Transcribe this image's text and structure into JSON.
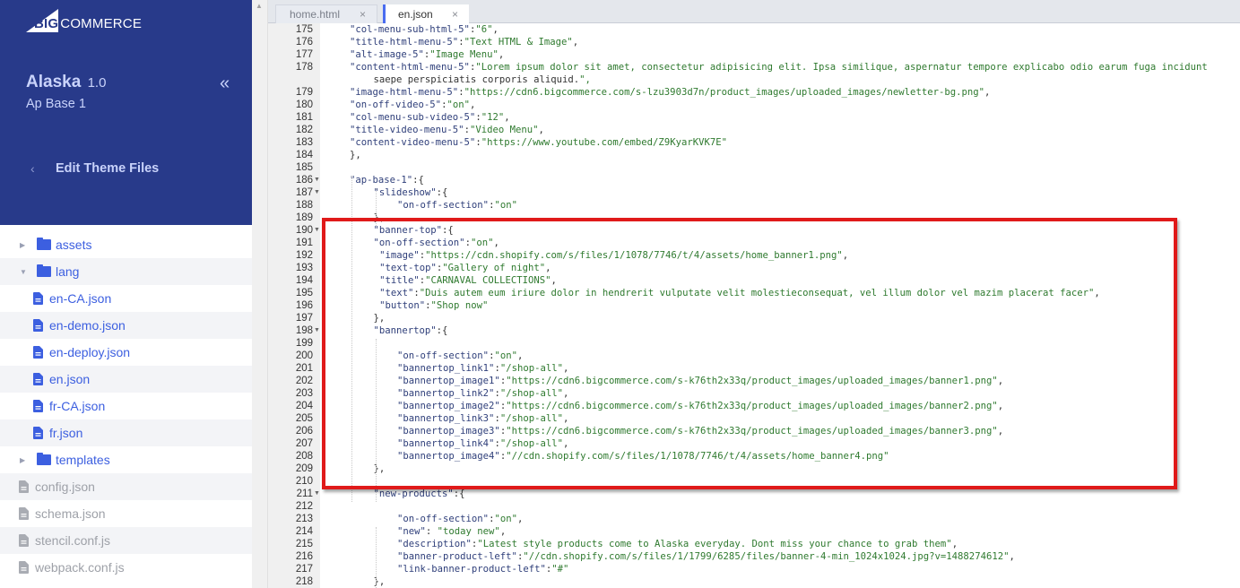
{
  "brand": {
    "logo_text_big": "BIG",
    "logo_text_rest": "COMMERCE",
    "accent": "#283a8a",
    "link_blue": "#3c5fe0"
  },
  "theme": {
    "name": "Alaska",
    "version": "1.0",
    "variant": "Ap Base 1"
  },
  "sidebar": {
    "collapse_icon": "double-chevron-left-icon",
    "back_label": "Edit Theme Files",
    "tree": [
      {
        "label": "assets",
        "type": "folder",
        "expanded": false,
        "level": 0
      },
      {
        "label": "lang",
        "type": "folder",
        "expanded": true,
        "level": 0
      },
      {
        "label": "en-CA.json",
        "type": "file",
        "level": 1
      },
      {
        "label": "en-demo.json",
        "type": "file",
        "level": 1
      },
      {
        "label": "en-deploy.json",
        "type": "file",
        "level": 1
      },
      {
        "label": "en.json",
        "type": "file",
        "level": 1
      },
      {
        "label": "fr-CA.json",
        "type": "file",
        "level": 1
      },
      {
        "label": "fr.json",
        "type": "file",
        "level": 1
      },
      {
        "label": "templates",
        "type": "folder",
        "expanded": false,
        "level": 0
      },
      {
        "label": "config.json",
        "type": "root-file",
        "level": 0
      },
      {
        "label": "schema.json",
        "type": "root-file",
        "level": 0
      },
      {
        "label": "stencil.conf.js",
        "type": "root-file",
        "level": 0
      },
      {
        "label": "webpack.conf.js",
        "type": "root-file",
        "level": 0
      }
    ]
  },
  "tabs": [
    {
      "label": "home.html",
      "active": false,
      "close": "×"
    },
    {
      "label": "en.json",
      "active": true,
      "close": "×"
    }
  ],
  "editor": {
    "lines": [
      {
        "n": "175",
        "ind": 1,
        "text": "\"col-menu-sub-html-5\":\"6\","
      },
      {
        "n": "176",
        "ind": 1,
        "text": "\"title-html-menu-5\":\"Text HTML & Image\","
      },
      {
        "n": "177",
        "ind": 1,
        "text": "\"alt-image-5\":\"Image Menu\","
      },
      {
        "n": "178",
        "ind": 1,
        "text": "\"content-html-menu-5\":\"Lorem ipsum dolor sit amet, consectetur adipisicing elit. Ipsa similique, aspernatur tempore explicabo odio earum fuga incidunt"
      },
      {
        "n": "",
        "ind": 2,
        "text": "saepe perspiciatis corporis aliquid.\","
      },
      {
        "n": "179",
        "ind": 1,
        "text": "\"image-html-menu-5\":\"https://cdn6.bigcommerce.com/s-lzu3903d7n/product_images/uploaded_images/newletter-bg.png\","
      },
      {
        "n": "180",
        "ind": 1,
        "text": "\"on-off-video-5\":\"on\","
      },
      {
        "n": "181",
        "ind": 1,
        "text": "\"col-menu-sub-video-5\":\"12\","
      },
      {
        "n": "182",
        "ind": 1,
        "text": "\"title-video-menu-5\":\"Video Menu\","
      },
      {
        "n": "183",
        "ind": 1,
        "text": "\"content-video-menu-5\":\"https://www.youtube.com/embed/Z9KyarKVK7E\""
      },
      {
        "n": "184",
        "ind": 1,
        "text": "},"
      },
      {
        "n": "185",
        "ind": 0,
        "text": ""
      },
      {
        "n": "186",
        "ind": 1,
        "text": "\"ap-base-1\":{",
        "fold": true
      },
      {
        "n": "187",
        "ind": 2,
        "text": "\"slideshow\":{",
        "fold": true
      },
      {
        "n": "188",
        "ind": 3,
        "text": "\"on-off-section\":\"on\""
      },
      {
        "n": "189",
        "ind": 2,
        "text": "},"
      },
      {
        "n": "190",
        "ind": 2,
        "text": "\"banner-top\":{",
        "fold": true
      },
      {
        "n": "191",
        "ind": 2,
        "text": "\"on-off-section\":\"on\","
      },
      {
        "n": "192",
        "ind": 2.25,
        "text": "\"image\":\"https://cdn.shopify.com/s/files/1/1078/7746/t/4/assets/home_banner1.png\","
      },
      {
        "n": "193",
        "ind": 2.25,
        "text": "\"text-top\":\"Gallery of night\","
      },
      {
        "n": "194",
        "ind": 2.25,
        "text": "\"title\":\"CARNAVAL COLLECTIONS\","
      },
      {
        "n": "195",
        "ind": 2.25,
        "text": "\"text\":\"Duis autem eum iriure dolor in hendrerit vulputate velit molestieconsequat, vel illum dolor vel mazim placerat facer\","
      },
      {
        "n": "196",
        "ind": 2.25,
        "text": "\"button\":\"Shop now\""
      },
      {
        "n": "197",
        "ind": 2,
        "text": "},"
      },
      {
        "n": "198",
        "ind": 2,
        "text": "\"bannertop\":{",
        "fold": true
      },
      {
        "n": "199",
        "ind": 0,
        "text": ""
      },
      {
        "n": "200",
        "ind": 3,
        "text": "\"on-off-section\":\"on\","
      },
      {
        "n": "201",
        "ind": 3,
        "text": "\"bannertop_link1\":\"/shop-all\","
      },
      {
        "n": "202",
        "ind": 3,
        "text": "\"bannertop_image1\":\"https://cdn6.bigcommerce.com/s-k76th2x33q/product_images/uploaded_images/banner1.png\","
      },
      {
        "n": "203",
        "ind": 3,
        "text": "\"bannertop_link2\":\"/shop-all\","
      },
      {
        "n": "204",
        "ind": 3,
        "text": "\"bannertop_image2\":\"https://cdn6.bigcommerce.com/s-k76th2x33q/product_images/uploaded_images/banner2.png\","
      },
      {
        "n": "205",
        "ind": 3,
        "text": "\"bannertop_link3\":\"/shop-all\","
      },
      {
        "n": "206",
        "ind": 3,
        "text": "\"bannertop_image3\":\"https://cdn6.bigcommerce.com/s-k76th2x33q/product_images/uploaded_images/banner3.png\","
      },
      {
        "n": "207",
        "ind": 3,
        "text": "\"bannertop_link4\":\"/shop-all\","
      },
      {
        "n": "208",
        "ind": 3,
        "text": "\"bannertop_image4\":\"//cdn.shopify.com/s/files/1/1078/7746/t/4/assets/home_banner4.png\""
      },
      {
        "n": "209",
        "ind": 2,
        "text": "},"
      },
      {
        "n": "210",
        "ind": 0,
        "text": ""
      },
      {
        "n": "211",
        "ind": 2,
        "text": "\"new-products\":{",
        "fold": true
      },
      {
        "n": "212",
        "ind": 0,
        "text": ""
      },
      {
        "n": "213",
        "ind": 3,
        "text": "\"on-off-section\":\"on\","
      },
      {
        "n": "214",
        "ind": 3,
        "text": "\"new\": \"today new\","
      },
      {
        "n": "215",
        "ind": 3,
        "text": "\"description\":\"Latest style products come to Alaska everyday. Dont miss your chance to grab them\","
      },
      {
        "n": "216",
        "ind": 3,
        "text": "\"banner-product-left\":\"//cdn.shopify.com/s/files/1/1799/6285/files/banner-4-min_1024x1024.jpg?v=1488274612\","
      },
      {
        "n": "217",
        "ind": 3,
        "text": "\"link-banner-product-left\":\"#\""
      },
      {
        "n": "218",
        "ind": 2,
        "text": "},"
      }
    ],
    "highlight": {
      "from_line": "190",
      "to_line": "210",
      "color": "#e01a1a"
    }
  }
}
